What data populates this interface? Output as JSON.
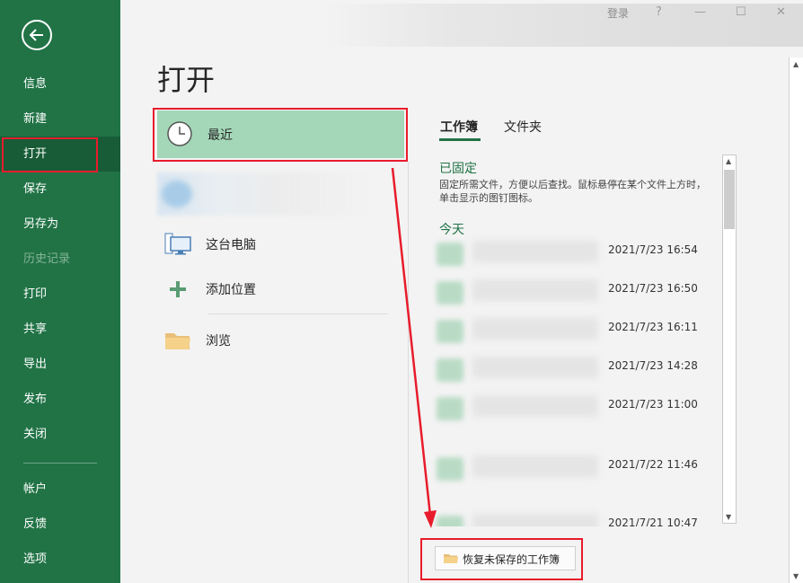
{
  "window": {
    "login_label": "登录",
    "help_label": "?",
    "minimize_label": "—",
    "restore_label": "☐",
    "close_label": "✕"
  },
  "sidebar": {
    "items": [
      {
        "label": "信息"
      },
      {
        "label": "新建"
      },
      {
        "label": "打开"
      },
      {
        "label": "保存"
      },
      {
        "label": "另存为"
      },
      {
        "label": "历史记录"
      },
      {
        "label": "打印"
      },
      {
        "label": "共享"
      },
      {
        "label": "导出"
      },
      {
        "label": "发布"
      },
      {
        "label": "关闭"
      },
      {
        "label": "帐户"
      },
      {
        "label": "反馈"
      },
      {
        "label": "选项"
      }
    ]
  },
  "page": {
    "title": "打开"
  },
  "locations": {
    "recent": "最近",
    "this_pc": "这台电脑",
    "add_place": "添加位置",
    "browse": "浏览"
  },
  "tabs": {
    "workbooks": "工作簿",
    "folders": "文件夹"
  },
  "pinned": {
    "heading": "已固定",
    "description": "固定所需文件，方便以后查找。鼠标悬停在某个文件上方时，单击显示的图钉图标。"
  },
  "today": {
    "heading": "今天"
  },
  "files": [
    {
      "time": "2021/7/23 16:54"
    },
    {
      "time": "2021/7/23 16:50"
    },
    {
      "time": "2021/7/23 16:11"
    },
    {
      "time": "2021/7/23 14:28"
    },
    {
      "time": "2021/7/23 11:00"
    },
    {
      "time": "2021/7/22 11:46"
    },
    {
      "time": "2021/7/21 10:47"
    }
  ],
  "recover_button": {
    "label": "恢复未保存的工作簿"
  },
  "colors": {
    "sidebar": "#217346",
    "sidebar_active": "#185c37",
    "recent_highlight": "#a4d7b8",
    "annotation_red": "#e81c2c"
  }
}
